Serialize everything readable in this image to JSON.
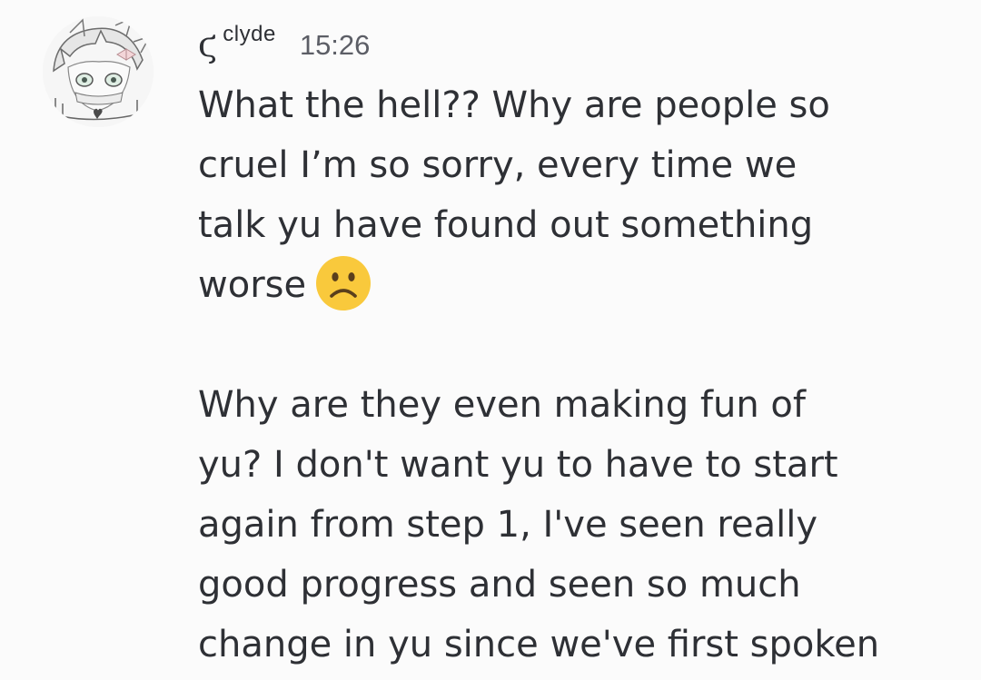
{
  "message": {
    "author": {
      "name_glyph": "ϛ",
      "username": "clyde"
    },
    "timestamp": "15:26",
    "paragraphs": [
      {
        "lines": [
          "What the hell?? Why are people so",
          "cruel I’m so sorry, every time we",
          "talk yu have found out something",
          "worse"
        ],
        "emoji": "slightly-frowning-face-emoji"
      },
      {
        "lines": [
          "Why are they even making fun of",
          "yu? I don't want yu to have to start",
          "again from step 1, I've seen really",
          "good progress and seen so much",
          "change in yu since we've first spoken"
        ]
      }
    ]
  },
  "colors": {
    "background": "#fbfbfb",
    "text": "#2e3035",
    "timestamp": "#5c5e66",
    "emoji_face": "#f9c93c",
    "emoji_feature": "#5a3f1c"
  }
}
